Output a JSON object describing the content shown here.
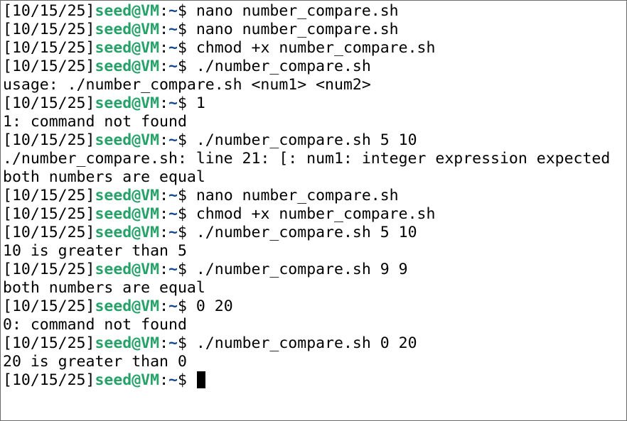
{
  "theme": {
    "background": "#ffffff",
    "text": "#000000",
    "user_host_color": "#26a269",
    "path_color": "#12488b"
  },
  "prompt": {
    "timestamp": "[10/15/25]",
    "user_host": "seed@VM",
    "separator": ":",
    "path": "~",
    "symbol": "$ "
  },
  "lines": [
    {
      "type": "prompt",
      "command": "nano number_compare.sh"
    },
    {
      "type": "prompt",
      "command": "nano number_compare.sh"
    },
    {
      "type": "prompt",
      "command": "chmod +x number_compare.sh"
    },
    {
      "type": "prompt",
      "command": "./number_compare.sh"
    },
    {
      "type": "output",
      "text": "usage: ./number_compare.sh <num1> <num2>"
    },
    {
      "type": "prompt",
      "command": "1"
    },
    {
      "type": "output",
      "text": "1: command not found"
    },
    {
      "type": "prompt",
      "command": "./number_compare.sh 5 10"
    },
    {
      "type": "output",
      "text": "./number_compare.sh: line 21: [: num1: integer expression expected"
    },
    {
      "type": "output",
      "text": "both numbers are equal"
    },
    {
      "type": "prompt",
      "command": "nano number_compare.sh"
    },
    {
      "type": "prompt",
      "command": "chmod +x number_compare.sh"
    },
    {
      "type": "prompt",
      "command": "./number_compare.sh 5 10"
    },
    {
      "type": "output",
      "text": "10 is greater than 5"
    },
    {
      "type": "prompt",
      "command": "./number_compare.sh 9 9"
    },
    {
      "type": "output",
      "text": "both numbers are equal"
    },
    {
      "type": "prompt",
      "command": "0 20"
    },
    {
      "type": "output",
      "text": "0: command not found"
    },
    {
      "type": "prompt",
      "command": "./number_compare.sh 0 20"
    },
    {
      "type": "output",
      "text": "20 is greater than 0"
    },
    {
      "type": "prompt",
      "command": "",
      "cursor": true
    }
  ]
}
